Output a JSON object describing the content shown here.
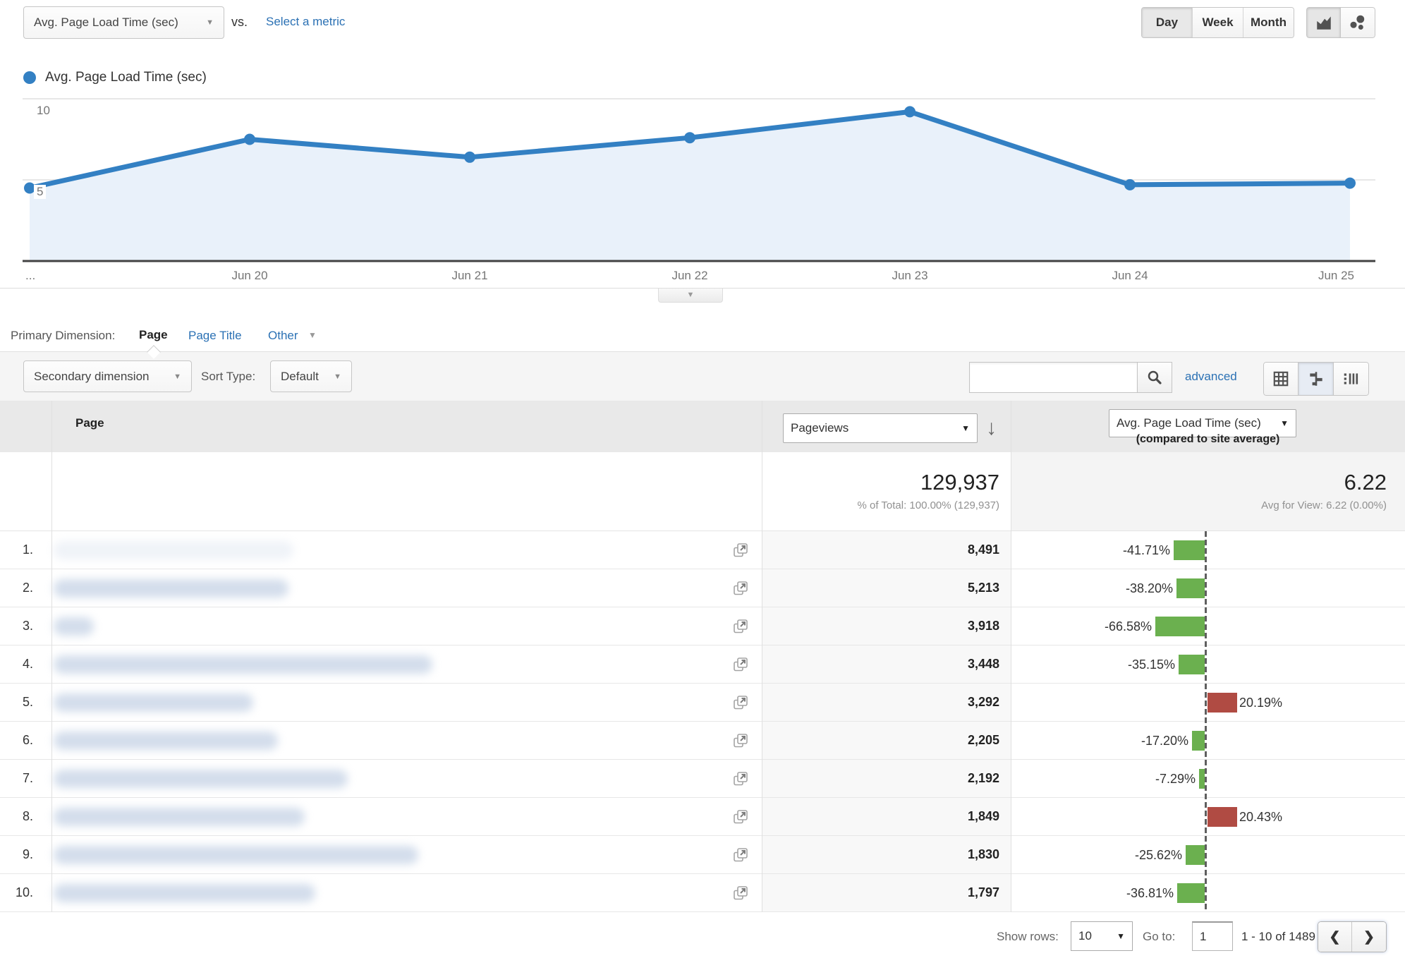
{
  "colors": {
    "chart_line": "#3380c3",
    "chart_fill": "#e9f1fa",
    "link": "#2b71b4",
    "bar_negative": "#6bb04f",
    "bar_positive": "#b04b43",
    "comparison_axis": "#5f5f5f"
  },
  "header": {
    "metric_select": "Avg. Page Load Time (sec)",
    "vs_label": "vs.",
    "select_metric_link": "Select a metric",
    "granularity": [
      "Day",
      "Week",
      "Month"
    ],
    "granularity_selected": "Day"
  },
  "legend": {
    "label": "Avg. Page Load Time (sec)"
  },
  "chart_data": {
    "type": "line",
    "title": "Avg. Page Load Time (sec)",
    "x": [
      "...",
      "Jun 20",
      "Jun 21",
      "Jun 22",
      "Jun 23",
      "Jun 24",
      "Jun 25"
    ],
    "series": [
      {
        "name": "Avg. Page Load Time (sec)",
        "values": [
          4.5,
          7.5,
          6.4,
          7.6,
          9.2,
          4.7,
          4.8
        ]
      }
    ],
    "ylim": [
      0,
      10
    ],
    "yticks": [
      5,
      10
    ],
    "grid": "horizontal",
    "legend_position": "top-left"
  },
  "dimension_bar": {
    "label": "Primary Dimension:",
    "tabs": [
      {
        "label": "Page",
        "selected": true
      },
      {
        "label": "Page Title",
        "selected": false
      },
      {
        "label": "Other",
        "selected": false
      }
    ]
  },
  "toolbar": {
    "secondary_dimension_label": "Secondary dimension",
    "sort_type_label": "Sort Type:",
    "sort_type_value": "Default",
    "advanced_link": "advanced",
    "search_value": ""
  },
  "table": {
    "columns": {
      "page": "Page",
      "pageviews": "Pageviews",
      "metric": "Avg. Page Load Time (sec)",
      "metric_caption": "(compared to site average)"
    },
    "totals": {
      "pageviews": "129,937",
      "pageviews_caption": "% of Total: 100.00% (129,937)",
      "metric": "6.22",
      "metric_caption": "Avg for View: 6.22 (0.00%)"
    },
    "rows": [
      {
        "rank": "1.",
        "pageviews": "8,491",
        "pct": "-41.71%",
        "pct_value": -41.71,
        "blur_width": 340,
        "faint": true
      },
      {
        "rank": "2.",
        "pageviews": "5,213",
        "pct": "-38.20%",
        "pct_value": -38.2,
        "blur_width": 333
      },
      {
        "rank": "3.",
        "pageviews": "3,918",
        "pct": "-66.58%",
        "pct_value": -66.58,
        "blur_width": 57
      },
      {
        "rank": "4.",
        "pageviews": "3,448",
        "pct": "-35.15%",
        "pct_value": -35.15,
        "blur_width": 537
      },
      {
        "rank": "5.",
        "pageviews": "3,292",
        "pct": "20.19%",
        "pct_value": 20.19,
        "blur_width": 283
      },
      {
        "rank": "6.",
        "pageviews": "2,205",
        "pct": "-17.20%",
        "pct_value": -17.2,
        "blur_width": 318
      },
      {
        "rank": "7.",
        "pageviews": "2,192",
        "pct": "-7.29%",
        "pct_value": -7.29,
        "blur_width": 417
      },
      {
        "rank": "8.",
        "pageviews": "1,849",
        "pct": "20.43%",
        "pct_value": 20.43,
        "blur_width": 356
      },
      {
        "rank": "9.",
        "pageviews": "1,830",
        "pct": "-25.62%",
        "pct_value": -25.62,
        "blur_width": 517
      },
      {
        "rank": "10.",
        "pageviews": "1,797",
        "pct": "-36.81%",
        "pct_value": -36.81,
        "blur_width": 371
      }
    ]
  },
  "pagination": {
    "show_rows_label": "Show rows:",
    "show_rows_value": "10",
    "goto_label": "Go to:",
    "goto_value": "1",
    "range": "1 - 10 of 1489"
  }
}
